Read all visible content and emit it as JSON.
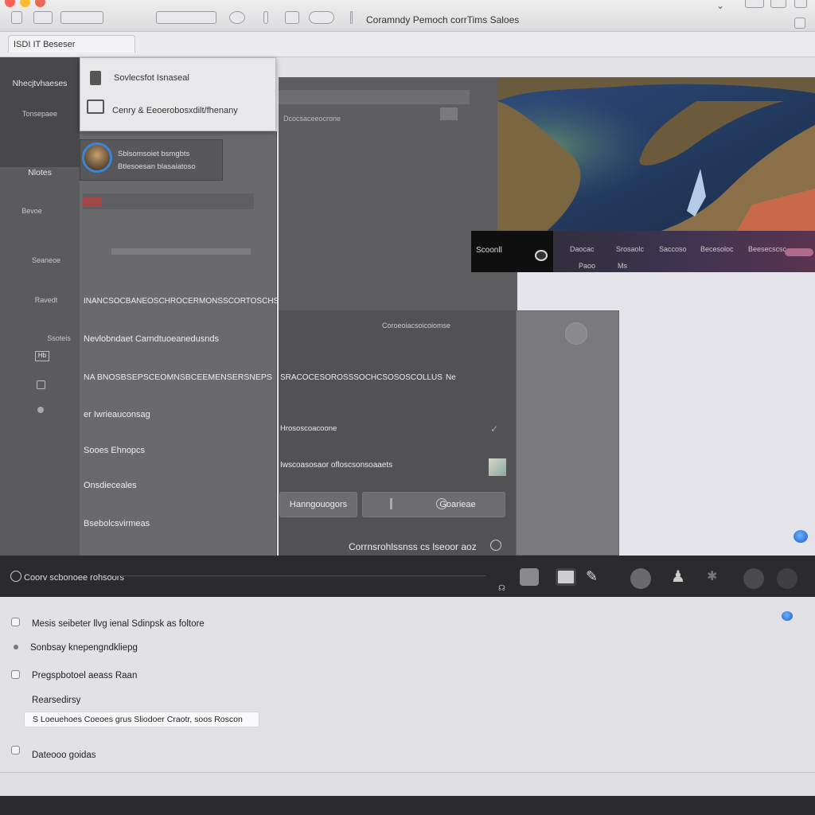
{
  "window": {
    "title": "Coramndy Pemoch corrTims Saloes",
    "traffic_lights": [
      "#ff5f57",
      "#febc2e",
      "#e86a5a"
    ]
  },
  "toolbar_icons": [
    "list-icon",
    "window-icon",
    "divider-icon",
    "grid-icon",
    "shape-icon",
    "bar-icon",
    "table-icon",
    "cloud-icon",
    "line-icon"
  ],
  "breadcrumb": "ISDI IT Beseser",
  "left_nav": {
    "heading": "Nhecjtvhaeses",
    "sub": "Tonsepaee",
    "items": [
      "Nlotes",
      "Bevoe",
      "Seaneoe",
      "Ravedt",
      "Ssoteis"
    ],
    "badge": "Hb"
  },
  "popup": {
    "item1": "Sovlecsfot Isnaseal",
    "item2": "Cenry & Eeoerobosxdilt/fhenany"
  },
  "profile": {
    "line1": "Sblsomsoiet bsmgbts",
    "line2": "Btlesoesan blasaiatoso"
  },
  "list_rows": [
    "INANCSOCBANEOSCHROCERMONSSCORTOSCHS WNISCS",
    "Nevlobndaet Carndtuoeanedusnds",
    "NA BNOSBSEPSCEOMNSBCEEMENSERSNEPS",
    "er Iwrieauconsag",
    "Sooes Ehnopcs",
    "Onsdieceales",
    "Bsebolcsvirmeas"
  ],
  "center": {
    "head": "Dcocsaceeocrone",
    "line1": "Coroeoiacsoicoiomse",
    "row1": "SRACOCESOROSSSOCHCSOSOSCOLLUS",
    "row1_suffix": "Ne",
    "row2": "Hrososcoacoone",
    "row3": "Iwscoasosaor ofloscsonsoaaets",
    "button1": "Hanngouogors",
    "button2": "Goarieae",
    "footer": "Corrnsrohlssnss cs lseoor aoz"
  },
  "strip": {
    "badge": "Scoonll",
    "items": [
      "Daocac",
      "Srosaolc",
      "Saccoso",
      "Becesoloc",
      "Beesecscsc"
    ],
    "sub": [
      "Paoo",
      "Ms"
    ]
  },
  "bottom_bar": {
    "label": "Coorv scbonoee rohsoors",
    "icons": [
      "table-icon",
      "image-icon",
      "pen-icon",
      "globe-icon",
      "person-icon",
      "star-icon",
      "gauge-icon",
      "clock-icon"
    ]
  },
  "settings": {
    "opt1": "Mesis seibeter llvg ienal Sdinpsk as foltore",
    "opt2": "Sonbsay knepengndkliepg",
    "opt3": "Pregspbotoel aeass Raan",
    "heading": "Rearsedirsy",
    "input_value": "S Loeuehoes Coeoes grus Sliodoer Craotr, soos Roscon",
    "opt4": "Dateooo goidas"
  }
}
